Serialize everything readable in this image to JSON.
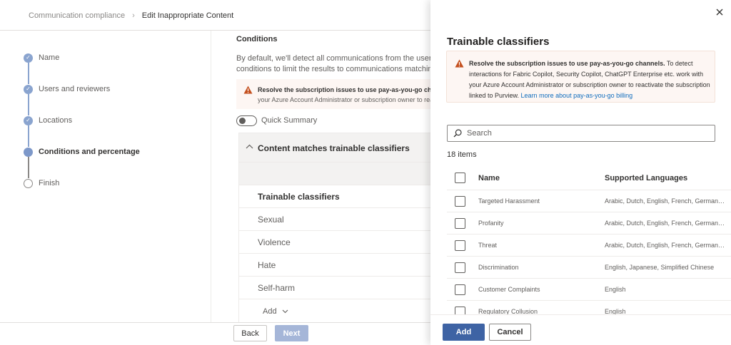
{
  "breadcrumb": {
    "parent": "Communication compliance",
    "separator": "›",
    "current": "Edit Inappropriate Content"
  },
  "steps": [
    {
      "label": "Name",
      "state": "complete"
    },
    {
      "label": "Users and reviewers",
      "state": "complete"
    },
    {
      "label": "Locations",
      "state": "complete"
    },
    {
      "label": "Conditions and percentage",
      "state": "current"
    },
    {
      "label": "Finish",
      "state": "pending"
    }
  ],
  "main": {
    "heading": "Conditions",
    "description_line1": "By default, we'll detect all communications from the users and",
    "description_line2": "conditions to limit the results to communications matching spec",
    "warning_title": "Resolve the subscription issues to use pay-as-you-go channels.",
    "warning_body": "your Azure Account Administrator or subscription owner to reactivate",
    "toggle_label": "Quick Summary",
    "condition_title": "Content matches trainable classifiers",
    "classifier_header": "Trainable classifiers",
    "classifiers": [
      "Sexual",
      "Violence",
      "Hate",
      "Self-harm"
    ],
    "add_label": "Add",
    "chevron_down": "⌵"
  },
  "footer": {
    "back": "Back",
    "next": "Next"
  },
  "panel": {
    "title": "Trainable classifiers",
    "warning": {
      "bold": "Resolve the subscription issues to use pay-as-you-go channels.",
      "text": " To detect interactions for Fabric Copilot, Security Copilot, ChatGPT Enterprise etc. work with your Azure Account Administrator or subscription owner to reactivate the subscription linked to Purview. ",
      "link": "Learn more about pay-as-you-go billing"
    },
    "search_placeholder": "Search",
    "item_count": "18 items",
    "columns": {
      "name": "Name",
      "languages": "Supported Languages"
    },
    "rows": [
      {
        "name": "Targeted Harassment",
        "languages": "Arabic, Dutch, English, French, German, ..."
      },
      {
        "name": "Profanity",
        "languages": "Arabic, Dutch, English, French, German, ..."
      },
      {
        "name": "Threat",
        "languages": "Arabic, Dutch, English, French, German, ..."
      },
      {
        "name": "Discrimination",
        "languages": "English, Japanese, Simplified Chinese"
      },
      {
        "name": "Customer Complaints",
        "languages": "English"
      },
      {
        "name": "Regulatory Collusion",
        "languages": "English"
      }
    ],
    "add_button": "Add",
    "cancel_button": "Cancel"
  },
  "colors": {
    "primary": "#3e63a4",
    "step_complete": "#8aa4cf",
    "warning_bg": "#fdf6f3",
    "warning_icon": "#c4501f",
    "link": "#0f6cbd"
  },
  "icons": [
    "close-icon",
    "search-icon",
    "warning-icon",
    "checkmark-icon",
    "chevron-up-icon",
    "chevron-down-icon",
    "chevron-right-icon"
  ]
}
